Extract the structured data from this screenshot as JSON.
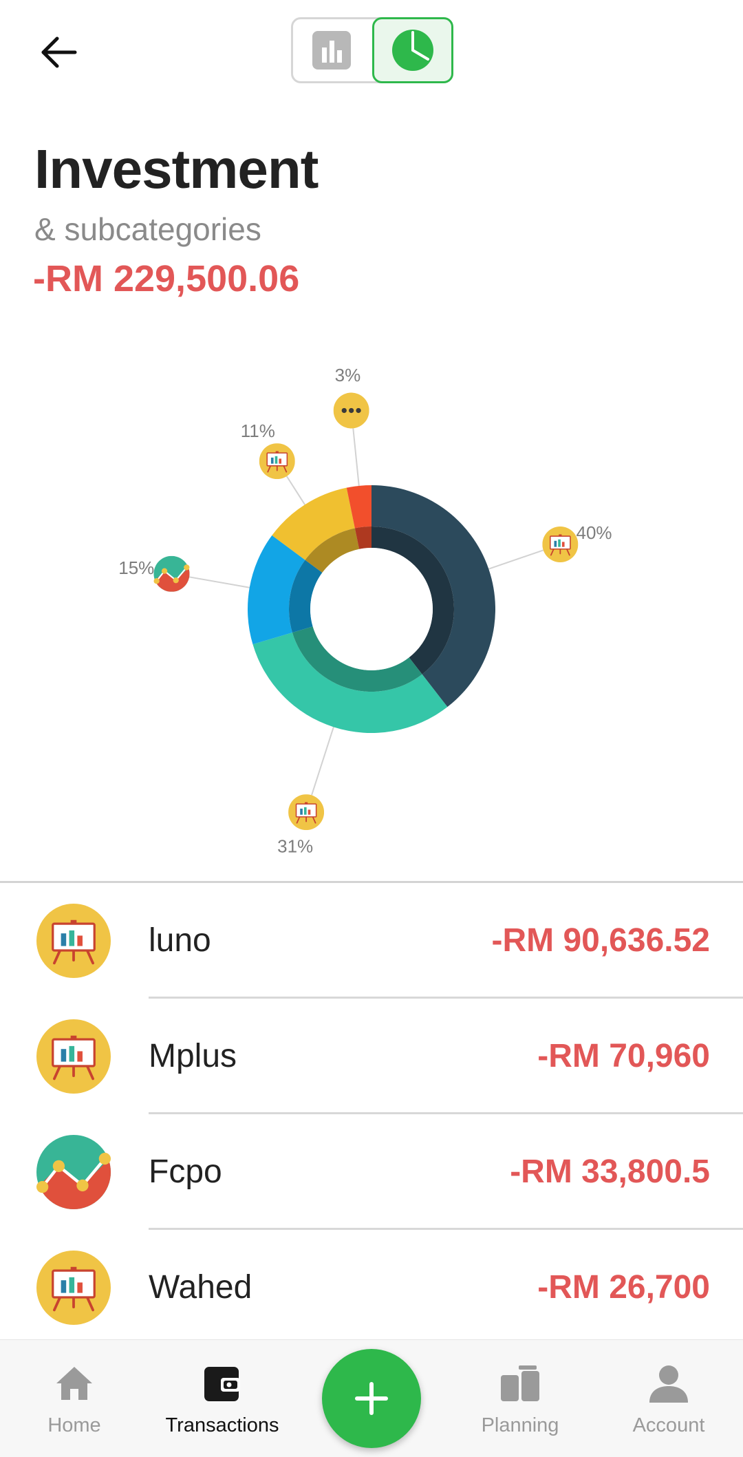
{
  "header": {
    "back_icon": "arrow-left-icon",
    "toggle": {
      "options": [
        "bar-chart-icon",
        "pie-chart-icon"
      ],
      "selected": "pie-chart-icon"
    },
    "title": "Investment",
    "subtitle": "& subcategories",
    "total": "-RM 229,500.06"
  },
  "colors": {
    "accent": "#2eb84b",
    "expense": "#e25757",
    "icon_bg": "#f0c445"
  },
  "chart_data": {
    "type": "pie",
    "donut": true,
    "slices": [
      {
        "label": "luno",
        "percent_label": "40%",
        "value": 90636.52,
        "color": "#2c4a5c",
        "icon": "presentation-board-icon"
      },
      {
        "label": "Mplus",
        "percent_label": "31%",
        "value": 70960,
        "color": "#35c6a8",
        "icon": "presentation-board-icon"
      },
      {
        "label": "Fcpo",
        "percent_label": "15%",
        "value": 33800.5,
        "color": "#12a5e6",
        "icon": "trend-chart-icon"
      },
      {
        "label": "Wahed",
        "percent_label": "11%",
        "value": 26700,
        "color": "#f0c030",
        "icon": "presentation-board-icon"
      },
      {
        "label": "Other",
        "percent_label": "3%",
        "value": 7403.04,
        "color": "#f24f2c",
        "icon": "more-dots-icon"
      }
    ]
  },
  "list": [
    {
      "name": "luno",
      "amount": "-RM 90,636.52",
      "icon": "presentation-board-icon"
    },
    {
      "name": "Mplus",
      "amount": "-RM 70,960",
      "icon": "presentation-board-icon"
    },
    {
      "name": "Fcpo",
      "amount": "-RM 33,800.5",
      "icon": "trend-chart-icon"
    },
    {
      "name": "Wahed",
      "amount": "-RM 26,700",
      "icon": "presentation-board-icon"
    }
  ],
  "bottom_nav": {
    "items": [
      {
        "label": "Home",
        "icon": "home-icon"
      },
      {
        "label": "Transactions",
        "icon": "wallet-icon",
        "active": true
      },
      {
        "label": "Planning",
        "icon": "planning-icon"
      },
      {
        "label": "Account",
        "icon": "account-icon"
      }
    ],
    "fab_icon": "plus-icon"
  }
}
